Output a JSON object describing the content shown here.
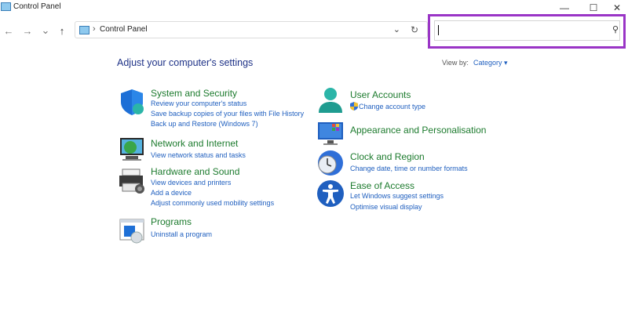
{
  "window": {
    "title": "Control Panel",
    "minimize": "—",
    "maximize": "☐",
    "close": "✕"
  },
  "nav": {
    "back": "←",
    "forward": "→",
    "recent": "⌄",
    "up": "↑",
    "address_sep": "›",
    "address_text": "Control Panel",
    "address_dropdown": "⌄",
    "refresh": "↻"
  },
  "search": {
    "value": "",
    "icon_glyph": "⚲",
    "highlight_color": "#9a35c6"
  },
  "main": {
    "heading": "Adjust your computer's settings",
    "view_by_label": "View by:",
    "view_by_value": "Category ▾"
  },
  "categories": {
    "system": {
      "title": "System and Security",
      "links": [
        "Review your computer's status",
        "Save backup copies of your files with File History",
        "Back up and Restore (Windows 7)"
      ]
    },
    "network": {
      "title": "Network and Internet",
      "links": [
        "View network status and tasks"
      ]
    },
    "hardware": {
      "title": "Hardware and Sound",
      "links": [
        "View devices and printers",
        "Add a device",
        "Adjust commonly used mobility settings"
      ]
    },
    "programs": {
      "title": "Programs",
      "links": [
        "Uninstall a program"
      ]
    },
    "user": {
      "title": "User Accounts",
      "links": [
        "Change account type"
      ]
    },
    "appearance": {
      "title": "Appearance and Personalisation",
      "links": []
    },
    "clock": {
      "title": "Clock and Region",
      "links": [
        "Change date, time or number formats"
      ]
    },
    "ease": {
      "title": "Ease of Access",
      "links": [
        "Let Windows suggest settings",
        "Optimise visual display"
      ]
    }
  },
  "colors": {
    "category_title": "#1d7b2e",
    "link": "#1f5fbf",
    "heading": "#1e3287"
  }
}
